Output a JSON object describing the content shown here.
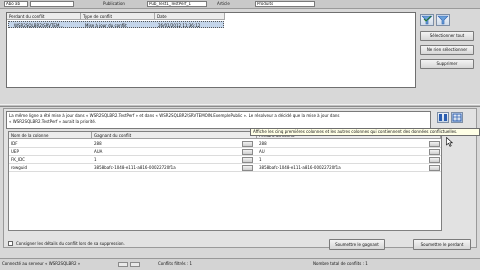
{
  "filter": {
    "subscriber_value": "Abo ab",
    "publication_label": "Publication",
    "publication_value": "Pub_Test1_TestPerf_1",
    "type_label": "Article",
    "type_value": "Produits"
  },
  "conflict_list": {
    "columns": [
      "Perdant du conflit",
      "Type de conflit",
      "Date"
    ],
    "rows": [
      {
        "loser": "WSR2SQLBR2\\SRVTEM...",
        "type": "Mise à jour du conflit",
        "date": "26/01/2012 11:36:12"
      }
    ]
  },
  "actions": {
    "select_all": "Sélectionner tout",
    "deselect": "Ne rien sélectionner",
    "delete": "Supprimer"
  },
  "message": {
    "line1": "La même ligne a été mise à jour dans « WSR2SQLBR2.TestPerf » et dans « WSR2SQLBR2\\SRVTEMOIN.ExemplePublic ». Le résolveur a décidé que la mise à jour dans",
    "line2": "« WSR2SQLBR2.TestPerf » aurait la priorité."
  },
  "tooltip": "Affiche les cinq premières colonnes et les autres colonnes qui contiennent des données conflictuelles.",
  "grid": {
    "columns": [
      "Nom de la colonne",
      "Gagnant du conflit",
      "Perdant du conflit"
    ],
    "rows": [
      {
        "name": "IDF",
        "winner": "288",
        "loser": "288"
      },
      {
        "name": "UEP",
        "winner": "AUA",
        "loser": "AU"
      },
      {
        "name": "FK_IDC",
        "winner": "1",
        "loser": "1"
      },
      {
        "name": "rowguid",
        "winner": "3858bafc-1048-e111-a816-00022720f1a",
        "loser": "3858bafc-1048-e111-a816-00022720f1a"
      }
    ]
  },
  "footer": {
    "log_checkbox": "Consigner les détails du conflit lors de sa suppression.",
    "submit_winner": "Soumettre le gagnant",
    "submit_loser": "Soumettre le perdant"
  },
  "status": {
    "connected": "Connecté au serveur « WSR2SQLBR2 »",
    "filtered": "Conflits filtrés : 1",
    "total": "Nombre total de conflits : 1"
  },
  "colors": {
    "selection": "#c4d5ea",
    "tooltip_bg": "#ffffe6",
    "accent": "#2a5db0"
  }
}
